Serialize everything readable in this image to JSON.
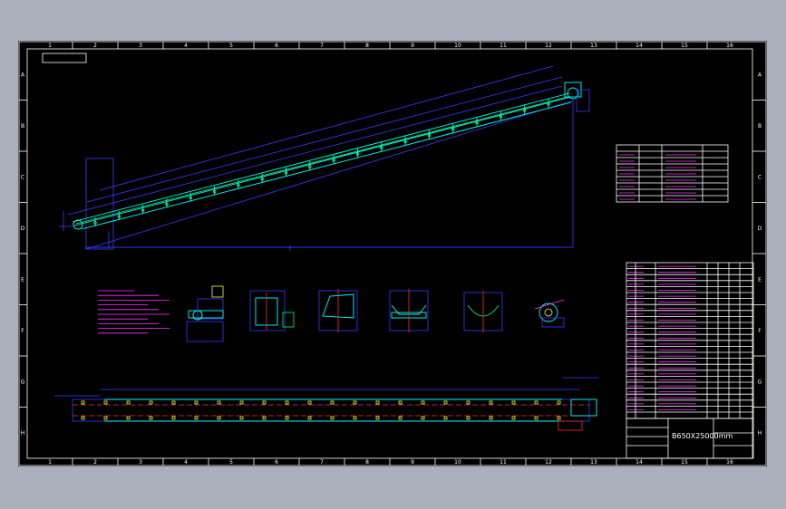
{
  "drawing": {
    "title_block_text": "B650X25000mm",
    "column_numbers": [
      "1",
      "2",
      "3",
      "4",
      "5",
      "6",
      "7",
      "8",
      "9",
      "10",
      "11",
      "12",
      "13",
      "14",
      "15",
      "16"
    ],
    "row_letters": [
      "A",
      "B",
      "C",
      "D",
      "E",
      "F",
      "G",
      "H"
    ]
  },
  "colors": {
    "paper": "#000000",
    "background": "#a9afbb",
    "frame": "#ffffff",
    "structure": "#3a3aff",
    "belt": "#00ffff",
    "notes": "#ff44ff",
    "centerline": "#ff2a2a"
  }
}
